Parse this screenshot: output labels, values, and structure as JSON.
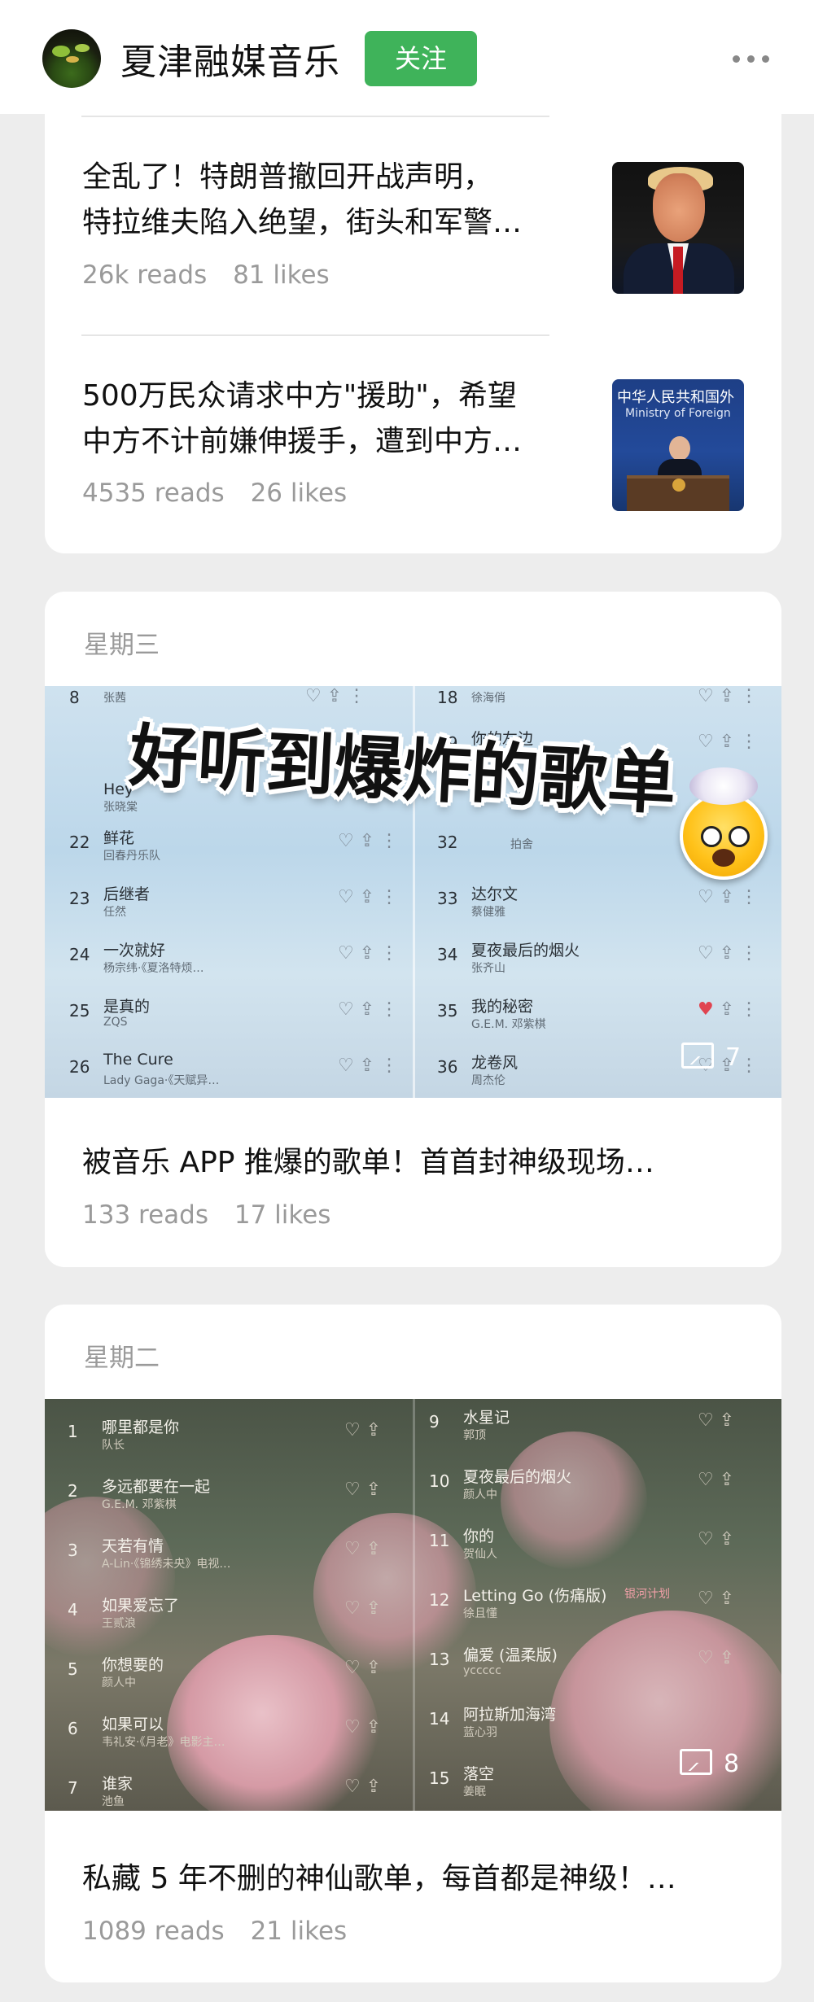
{
  "header": {
    "account_name": "夏津融媒音乐",
    "follow_label": "关注"
  },
  "articles_top": [
    {
      "title_line1": "全乱了！特朗普撤回开战声明，",
      "title_line2": "特拉维夫陷入绝望，街头和军警…",
      "reads": "26k reads",
      "likes": "81 likes",
      "thumb_icon": "trump-photo"
    },
    {
      "title_line1": "500万民众请求中方\"援助\"，希望",
      "title_line2": "中方不计前嫌伸援手，遭到中方…",
      "reads": "4535 reads",
      "likes": "26 likes",
      "thumb_icon": "press-conference-photo",
      "thumb_text1": "中华人民共和国外",
      "thumb_text2": "Ministry of Foreign"
    }
  ],
  "post_wed": {
    "day": "星期三",
    "banner": "好听到爆炸的歌单",
    "image_count": "7",
    "title": "被音乐 APP 推爆的歌单！首首封神级现场…",
    "reads": "133 reads",
    "likes": "17 likes",
    "left_rows": [
      {
        "num": "8",
        "song": "",
        "artist": "张茜"
      },
      {
        "num": "",
        "song": "Hey",
        "artist": "张晓棠"
      },
      {
        "num": "22",
        "song": "鲜花",
        "artist": "回春丹乐队"
      },
      {
        "num": "23",
        "song": "后继者",
        "artist": "任然"
      },
      {
        "num": "24",
        "song": "一次就好",
        "artist": "杨宗纬·《夏洛特烦…"
      },
      {
        "num": "25",
        "song": "是真的",
        "artist": "ZQS"
      },
      {
        "num": "26",
        "song": "The Cure",
        "artist": "Lady Gaga·《天赋异…"
      }
    ],
    "right_rows": [
      {
        "num": "18",
        "song": "",
        "artist": "徐海俏"
      },
      {
        "num": "19",
        "song": "你的左边",
        "artist": "许杉月"
      },
      {
        "num": "32",
        "song": "",
        "artist": "拍舍"
      },
      {
        "num": "33",
        "song": "达尔文",
        "artist": "蔡健雅"
      },
      {
        "num": "34",
        "song": "夏夜最后的烟火",
        "artist": "张齐山"
      },
      {
        "num": "35",
        "song": "我的秘密",
        "artist": "G.E.M. 邓紫棋"
      },
      {
        "num": "36",
        "song": "龙卷风",
        "artist": "周杰伦"
      }
    ]
  },
  "post_tue": {
    "day": "星期二",
    "image_count": "8",
    "title": "私藏 5 年不删的神仙歌单，每首都是神级！…",
    "reads": "1089 reads",
    "likes": "21 likes",
    "left_rows": [
      {
        "num": "1",
        "song": "哪里都是你",
        "artist": "队长"
      },
      {
        "num": "2",
        "song": "多远都要在一起",
        "artist": "G.E.M. 邓紫棋"
      },
      {
        "num": "3",
        "song": "天若有情",
        "artist": "A-Lin·《锦绣未央》电视…"
      },
      {
        "num": "4",
        "song": "如果爱忘了",
        "artist": "王贰浪"
      },
      {
        "num": "5",
        "song": "你想要的",
        "artist": "颜人中"
      },
      {
        "num": "6",
        "song": "如果可以",
        "artist": "韦礼安·《月老》电影主…"
      },
      {
        "num": "7",
        "song": "谁家",
        "artist": "池鱼"
      }
    ],
    "right_rows": [
      {
        "num": "9",
        "song": "水星记",
        "artist": "郭顶"
      },
      {
        "num": "10",
        "song": "夏夜最后的烟火",
        "artist": "颜人中"
      },
      {
        "num": "11",
        "song": "你的",
        "artist": "贺仙人"
      },
      {
        "num": "12",
        "song": "Letting Go (伤痛版)",
        "artist": "徐且懂"
      },
      {
        "num": "13",
        "song": "偏爱 (温柔版)",
        "artist": "yccccc"
      },
      {
        "num": "14",
        "song": "阿拉斯加海湾",
        "artist": "蓝心羽"
      },
      {
        "num": "15",
        "song": "落空",
        "artist": "姜眠"
      }
    ],
    "right_badge": "银河计划"
  }
}
